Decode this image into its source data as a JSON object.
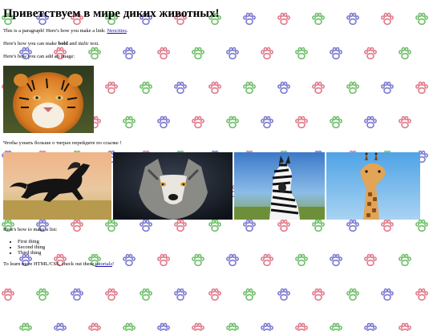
{
  "page": {
    "title": "Приветствуем в мире диких животных!",
    "para_link_prefix": "This is a paragraph! Here's how you make a link:",
    "link_neocities": "Neocities",
    "bold_prefix": "Here's how you can make",
    "bold_word": "bold",
    "and_word": "and",
    "italic_word": "italic",
    "text_suffix": "text.",
    "image_intro": "Here's how you can add an image:",
    "tiger_caption": "Чтобы узнать больше о тиграх перейдите по ссылке !",
    "list_intro": "Here's how to make a list:",
    "list_items": [
      "First thing",
      "Second thing",
      "Third thing"
    ],
    "learn_prefix": "To learn more HTML/CSS, check out these",
    "link_tutorials": "tutorials"
  },
  "images": [
    "tiger",
    "horse",
    "wolf",
    "zebra",
    "giraffe"
  ],
  "background": {
    "pattern": "paw-prints",
    "colors": [
      "#6fbf6a",
      "#7c7ad0",
      "#e07a8a"
    ]
  }
}
